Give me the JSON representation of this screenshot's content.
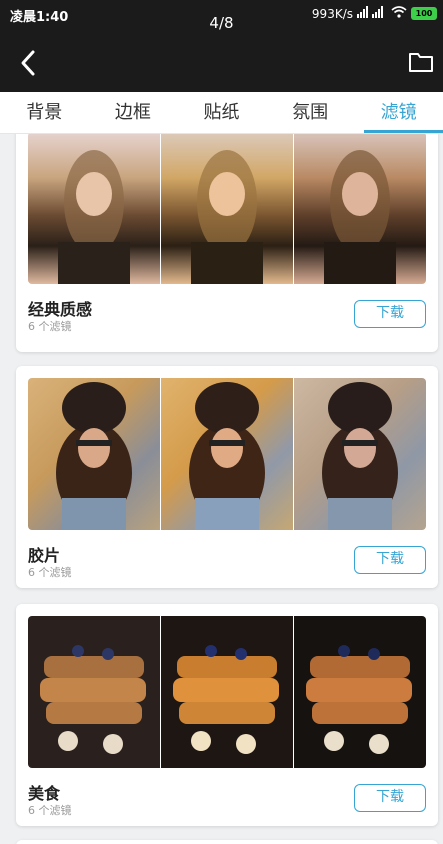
{
  "status": {
    "time": "凌晨1:40",
    "network_speed": "993K/s",
    "battery": "100"
  },
  "nav": {
    "page_counter": "4/8"
  },
  "tabs": [
    {
      "label": "背景"
    },
    {
      "label": "边框"
    },
    {
      "label": "贴纸"
    },
    {
      "label": "氛围"
    },
    {
      "label": "滤镜",
      "active": true
    }
  ],
  "filters": [
    {
      "title": "经典质感",
      "count": "6 个滤镜",
      "button": "下载"
    },
    {
      "title": "胶片",
      "count": "6 个滤镜",
      "button": "下载"
    },
    {
      "title": "美食",
      "count": "6 个滤镜",
      "button": "下载"
    }
  ],
  "colors": {
    "accent": "#37a5d3",
    "header_bg": "#1b1b1b"
  }
}
